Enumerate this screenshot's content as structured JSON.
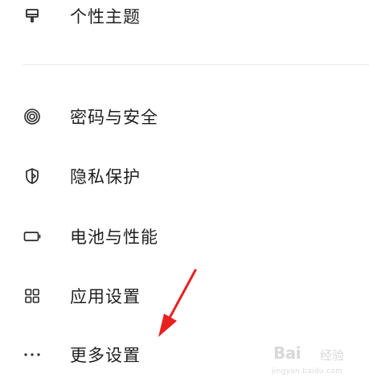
{
  "settings": {
    "items": [
      {
        "label": "个性主题",
        "icon": "theme-brush-icon"
      },
      {
        "label": "密码与安全",
        "icon": "fingerprint-icon"
      },
      {
        "label": "隐私保护",
        "icon": "privacy-shield-icon"
      },
      {
        "label": "电池与性能",
        "icon": "battery-icon"
      },
      {
        "label": "应用设置",
        "icon": "grid-apps-icon"
      },
      {
        "label": "更多设置",
        "icon": "more-dots-icon"
      }
    ]
  },
  "annotation": {
    "arrow_color": "#e8211f"
  },
  "watermark": {
    "logo": "Bai",
    "sub": "经验",
    "url": "jingyan.baidu.com"
  }
}
